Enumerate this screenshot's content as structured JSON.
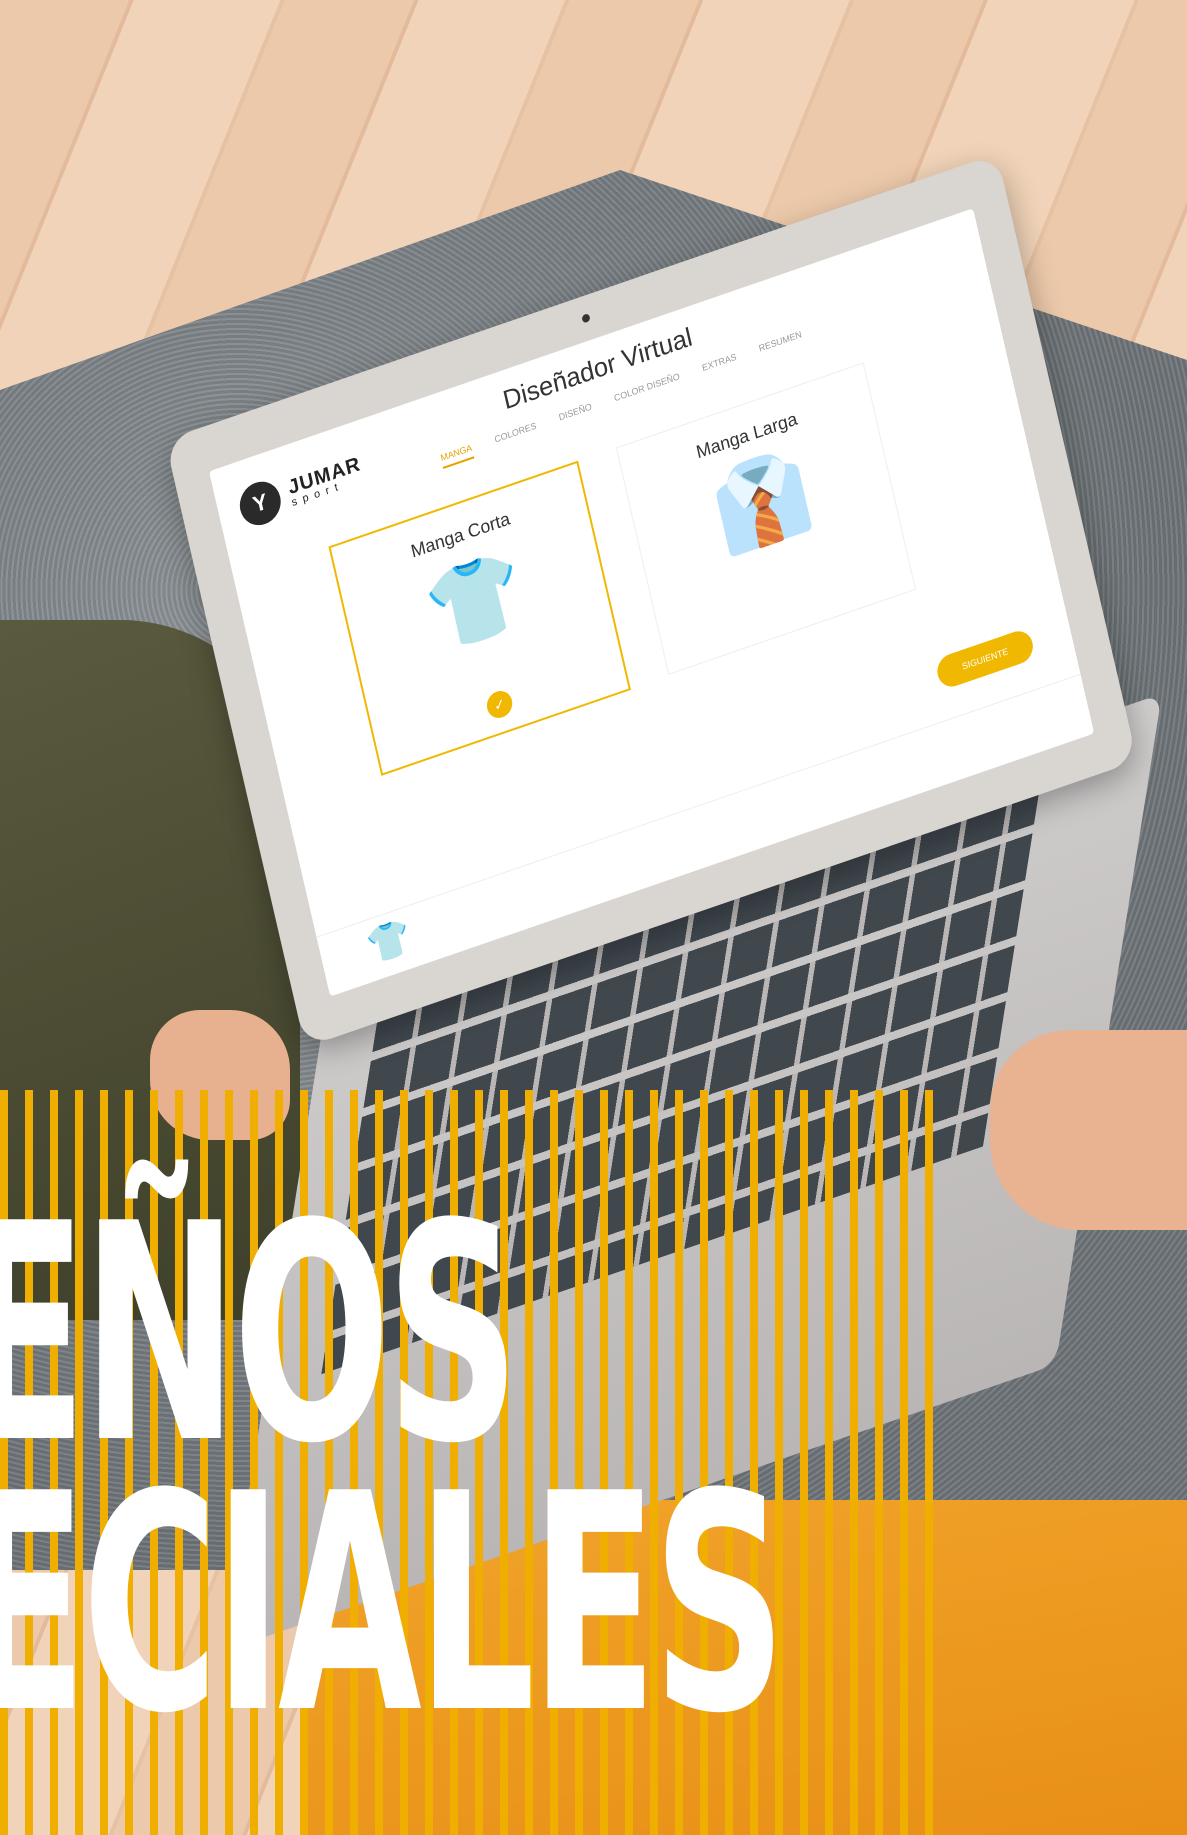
{
  "app": {
    "title": "Diseñador Virtual",
    "logo_text": "JUMAR",
    "logo_sub": "sport",
    "steps": [
      "MANGA",
      "COLORES",
      "DISEÑO",
      "COLOR DISEÑO",
      "EXTRAS",
      "RESUMEN"
    ],
    "active_step": "MANGA",
    "options": [
      {
        "label": "Manga Corta",
        "selected": true
      },
      {
        "label": "Manga Larga",
        "selected": false
      }
    ],
    "next_label": "SIGUIENTE"
  },
  "headline": {
    "line1": "EÑOS",
    "line2": "ECIALES"
  },
  "colors": {
    "accent": "#f0b800",
    "stripe": "#f0ae00",
    "sweater": "#e88f16"
  },
  "icons": {
    "shirt": "shirt-icon",
    "check": "check-icon"
  }
}
